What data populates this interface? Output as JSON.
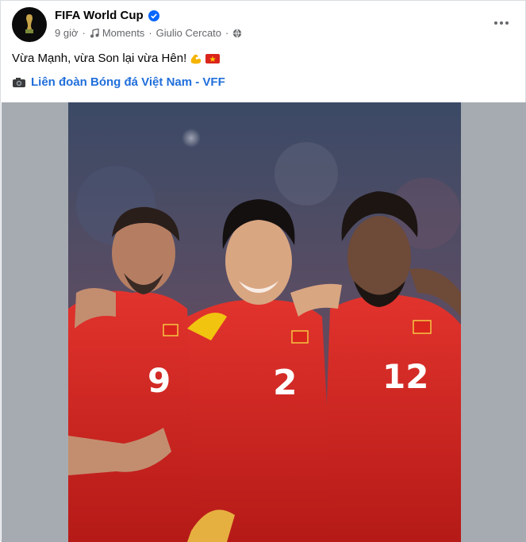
{
  "post": {
    "page_name": "FIFA World Cup",
    "time": "9 giờ",
    "separator": "·",
    "music": "Moments",
    "artist": "Giulio Cercato",
    "caption": "Vừa Mạnh, vừa Son lại vừa Hên!",
    "credit": "Liên đoàn Bóng đá Việt Nam - VFF"
  },
  "photo": {
    "players": [
      {
        "number": "9"
      },
      {
        "number": "2"
      },
      {
        "number": "12"
      }
    ]
  },
  "icons": {
    "verified": "verified-badge-icon",
    "music": "music-note-icon",
    "audience": "globe-icon",
    "more": "more-horizontal-icon",
    "camera": "camera-icon",
    "muscle": "flexed-biceps-emoji",
    "flag": "vietnam-flag-emoji"
  },
  "colors": {
    "link": "#216fdb",
    "verified": "#0866ff",
    "jersey": "#d7231f"
  }
}
